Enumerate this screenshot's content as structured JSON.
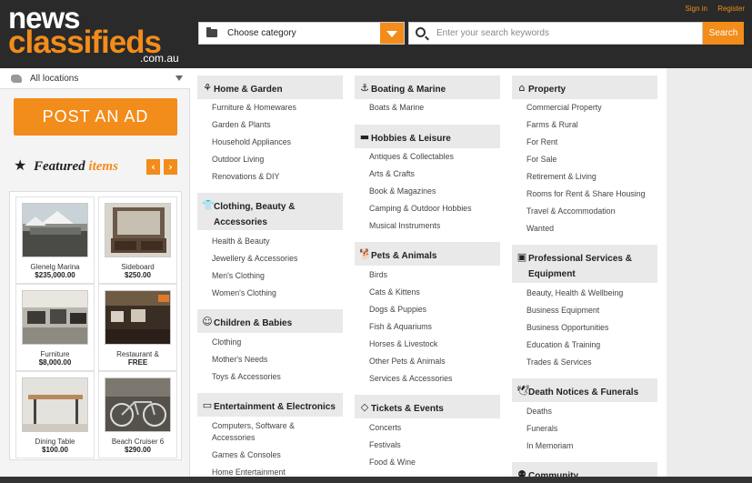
{
  "header": {
    "logo_news": "news",
    "logo_classifieds": "classifieds",
    "logo_domain": ".com.au",
    "links": [
      "Sign in",
      "Register"
    ],
    "category_select": "Choose category",
    "search_placeholder": "Enter your search keywords",
    "search_button": "Search"
  },
  "sidebar": {
    "location": "All locations",
    "post_ad": "POST AN AD",
    "featured_word": "Featured",
    "featured_accent": "items",
    "items": [
      {
        "name": "Glenelg Marina",
        "price": "$235,000.00"
      },
      {
        "name": "Sideboard",
        "price": "$250.00"
      },
      {
        "name": "Furniture",
        "price": "$8,000.00"
      },
      {
        "name": "Restaurant &",
        "price": "FREE"
      },
      {
        "name": "Dining Table",
        "price": "$100.00"
      },
      {
        "name": "Beach Cruiser 6",
        "price": "$290.00"
      }
    ]
  },
  "categories": {
    "col1": [
      {
        "title": "Home & Garden",
        "links": [
          "Furniture & Homewares",
          "Garden & Plants",
          "Household Appliances",
          "Outdoor Living",
          "Renovations & DIY"
        ]
      },
      {
        "title_line1": "Clothing, Beauty &",
        "title_line2": "Accessories",
        "links": [
          "Health & Beauty",
          "Jewellery & Accessories",
          "Men's Clothing",
          "Women's Clothing"
        ]
      },
      {
        "title": "Children & Babies",
        "links": [
          "Clothing",
          "Mother's Needs",
          "Toys & Accessories"
        ]
      },
      {
        "title": "Entertainment & Electronics",
        "links": [
          "Computers, Software &",
          "Accessories",
          "Games & Consoles",
          "Home Entertainment"
        ]
      }
    ],
    "col2": [
      {
        "title": "Boating & Marine",
        "links": [
          "Boats & Marine"
        ]
      },
      {
        "title": "Hobbies & Leisure",
        "links": [
          "Antiques & Collectables",
          "Arts & Crafts",
          "Book & Magazines",
          "Camping & Outdoor Hobbies",
          "Musical Instruments"
        ]
      },
      {
        "title": "Pets & Animals",
        "links": [
          "Birds",
          "Cats & Kittens",
          "Dogs & Puppies",
          "Fish & Aquariums",
          "Horses & Livestock",
          "Other Pets & Animals",
          "Services & Accessories"
        ]
      },
      {
        "title": "Tickets & Events",
        "links": [
          "Concerts",
          "Festivals",
          "Food & Wine"
        ]
      }
    ],
    "col3": [
      {
        "title": "Property",
        "links": [
          "Commercial Property",
          "Farms & Rural",
          "For Rent",
          "For Sale",
          "Retirement & Living",
          "Rooms for Rent & Share Housing",
          "Travel & Accommodation",
          "Wanted"
        ]
      },
      {
        "title_line1": "Professional Services &",
        "title_line2": "Equipment",
        "links": [
          "Beauty, Health & Wellbeing",
          "Business Equipment",
          "Business Opportunities",
          "Education & Training",
          "Trades & Services"
        ]
      },
      {
        "title": "Death Notices & Funerals",
        "links": [
          "Deaths",
          "Funerals",
          "In Memoriam"
        ]
      },
      {
        "title": "Community",
        "links": []
      }
    ]
  },
  "colors": {
    "accent": "#f28c1a",
    "header_bg": "#2a2a2a"
  }
}
